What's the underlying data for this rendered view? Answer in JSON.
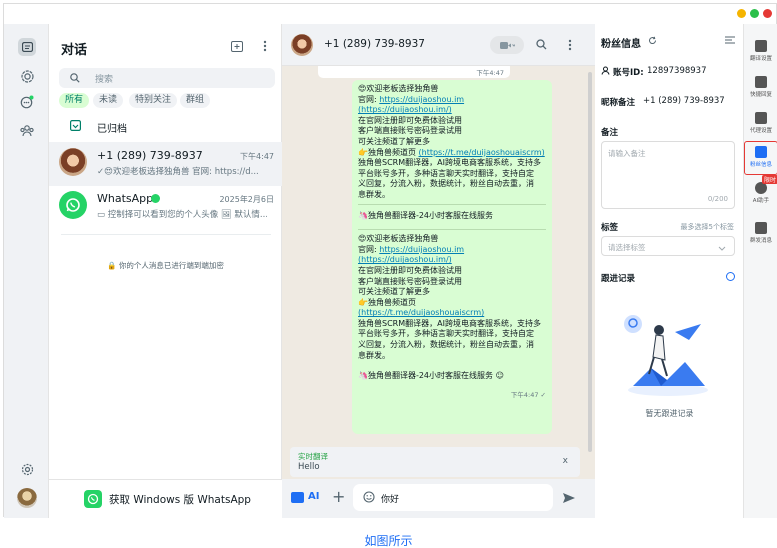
{
  "window": {
    "controls": [
      "#f5b400",
      "#2bbf4a",
      "#e53935"
    ]
  },
  "sidebar": {
    "colors": {
      "bg": "#f0f2f5",
      "icon": "#54656f"
    }
  },
  "chat_list": {
    "title": "对话",
    "search_placeholder": "搜索",
    "filters": [
      "所有",
      "未读",
      "特别关注",
      "群组"
    ],
    "archived_label": "已归档",
    "chats": [
      {
        "name": "+1 (289) 739-8937",
        "time": "下午4:47",
        "preview": "✓😍欢迎老板选择独角兽 官网: https://d..."
      },
      {
        "name": "WhatsApp",
        "time": "2025年2月6日",
        "preview": "▭ 控制择可以看到您的个人头像 🖼 默认情..."
      }
    ],
    "encryption_notice": "🔒 你的个人消息已进行端到端加密",
    "get_windows": "获取 Windows 版 WhatsApp"
  },
  "chat": {
    "contact": "+1 (289) 739-8937",
    "top_bubble_time": "下午4:47",
    "message": {
      "block1": [
        {
          "t": "😍欢迎老板选择独角兽"
        },
        {
          "t": "官网: ",
          "link": "https://duijaoshou.im"
        },
        {
          "link": "(https://duijaoshou.im/)"
        },
        {
          "t": "在官网注册即可免费体验试用"
        },
        {
          "t": "客户端直接账号密码登录试用"
        },
        {
          "t": "可关注频道了解更多"
        },
        {
          "t": "👉独角兽频道页 ",
          "link": "(https://t.me/duijaoshouaiscrm)"
        },
        {
          "t": "独角兽SCRM翻译器，AI跨境电商客服系统，支持多"
        },
        {
          "t": "平台账号多开，多种语言聊天实时翻译，支持自定"
        },
        {
          "t": "义回复，分流入粉，数据统计，粉丝自动去重，消"
        },
        {
          "t": "息群发。"
        }
      ],
      "divider1": "🦄独角兽翻译器-24小时客服在线服务",
      "block2": [
        {
          "t": "😍欢迎老板选择独角兽"
        },
        {
          "t": "官网: ",
          "link": "https://duijaoshou.im"
        },
        {
          "link": " (https://duijaoshou.im/)"
        },
        {
          "t": "在官网注册即可免费体验试用"
        },
        {
          "t": "客户端直接账号密码登录试用"
        },
        {
          "t": "可关注频道了解更多"
        },
        {
          "t": "👉独角兽频道页"
        },
        {
          "link": "(https://t.me/duijaoshouaiscrm)"
        },
        {
          "t": "独角兽SCRM翻译器，AI跨境电商客服系统，支持多"
        },
        {
          "t": "平台账号多开，多种语言聊天实时翻译，支持自定"
        },
        {
          "t": "义回复，分流入粉，数据统计，粉丝自动去重，消"
        },
        {
          "t": "息群发。"
        }
      ],
      "divider2": "🦄独角兽翻译器-24小时客服在线服务 ☺",
      "time": "下午4:47 ✓"
    },
    "translate": {
      "label": "实时翻译",
      "text": "Hello",
      "close": "x"
    },
    "input": {
      "ai_label": "AI",
      "plus": "+",
      "value": "你好"
    }
  },
  "panel": {
    "title": "粉丝信息",
    "account_label": "账号ID:",
    "account_id": "12897398937",
    "nickname_label": "昵称备注",
    "nickname_value": "+1 (289) 739-8937",
    "notes_label": "备注",
    "notes_placeholder": "请输入备注",
    "notes_count": "0/200",
    "tags_label": "标签",
    "tags_hint": "最多选择5个标签",
    "tags_placeholder": "请选择标签",
    "followup_label": "跟进记录",
    "followup_empty": "暂无跟进记录"
  },
  "tools": [
    {
      "label": "翻译设置"
    },
    {
      "label": "快捷回复"
    },
    {
      "label": "代理设置"
    },
    {
      "label": "粉丝信息"
    },
    {
      "label": "AI助手",
      "badge": "限时"
    },
    {
      "label": "群发消息"
    }
  ],
  "caption": "如图所示"
}
